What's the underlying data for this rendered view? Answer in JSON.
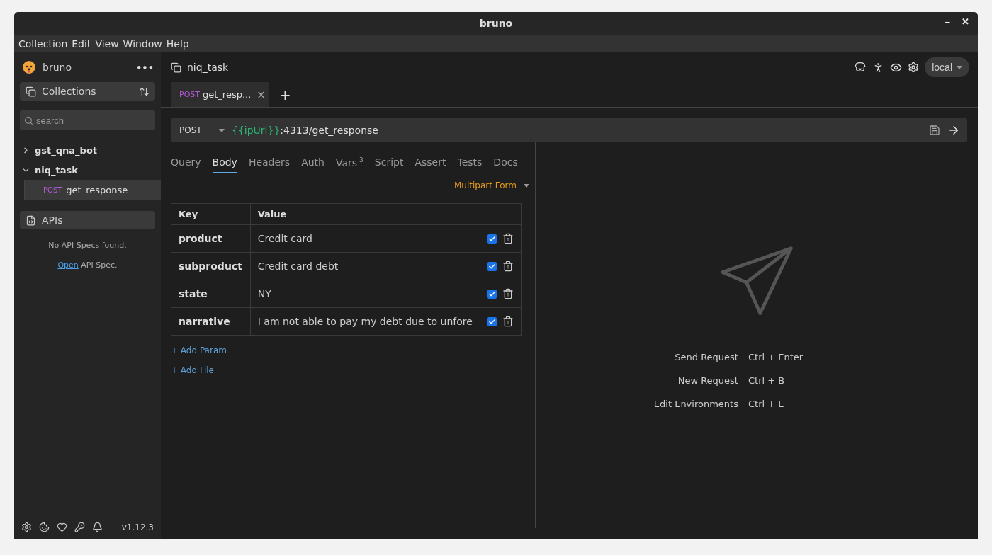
{
  "window": {
    "title": "bruno",
    "controls": [
      "–",
      "✕"
    ]
  },
  "menu": [
    "Collection",
    "Edit",
    "View",
    "Window",
    "Help"
  ],
  "sidebar": {
    "app_name": "bruno",
    "more": "•••",
    "collections_label": "Collections",
    "search": {
      "placeholder": "search"
    },
    "tree": [
      {
        "name": "gst_qna_bot",
        "expanded": false
      },
      {
        "name": "niq_task",
        "expanded": true,
        "children": [
          {
            "method": "POST",
            "name": "get_response",
            "selected": true
          }
        ]
      }
    ],
    "apis_label": "APIs",
    "apis_empty": "No API Specs found.",
    "apis_link": "Open",
    "apis_link_rest": " API Spec.",
    "version": "v1.12.3"
  },
  "header": {
    "collection": "niq_task",
    "environment": "local"
  },
  "request_tabs": [
    {
      "method": "POST",
      "name": "get_resp...",
      "selected": true,
      "close": "×"
    }
  ],
  "new_tab": "+",
  "url_bar": {
    "method": "POST",
    "url": [
      {
        "text": "{{ipUrl}}",
        "kind": "variable"
      },
      {
        "text": ":4313/get_response",
        "kind": "plain"
      }
    ]
  },
  "pane_tabs": [
    {
      "label": "Query",
      "selected": false
    },
    {
      "label": "Body",
      "selected": true
    },
    {
      "label": "Headers",
      "selected": false
    },
    {
      "label": "Auth",
      "selected": false
    },
    {
      "label": "Vars",
      "count": "3",
      "selected": false
    },
    {
      "label": "Script",
      "selected": false
    },
    {
      "label": "Assert",
      "selected": false
    },
    {
      "label": "Tests",
      "selected": false
    },
    {
      "label": "Docs",
      "selected": false
    }
  ],
  "body_mode": "Multipart Form",
  "table": {
    "columns": [
      "Key",
      "Value"
    ],
    "rows": [
      {
        "key": "product",
        "value": "Credit card",
        "checked": true
      },
      {
        "key": "subproduct",
        "value": "Credit card debt",
        "checked": true
      },
      {
        "key": "state",
        "value": "NY",
        "checked": true
      },
      {
        "key": "narrative",
        "value": "I am not able to pay my debt due to unfore",
        "checked": true
      }
    ]
  },
  "actions": [
    "+ Add Param",
    "+ Add File"
  ],
  "shortcuts": [
    {
      "label": "Send Request",
      "keys": "Ctrl + Enter"
    },
    {
      "label": "New Request",
      "keys": "Ctrl + B"
    },
    {
      "label": "Edit Environments",
      "keys": "Ctrl + E"
    }
  ]
}
